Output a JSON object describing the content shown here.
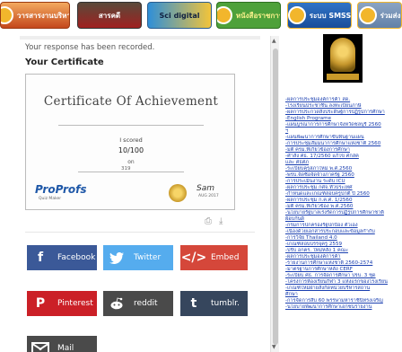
{
  "banners": [
    {
      "name": "banner-school-th",
      "text": "วารสารงานบริหาร"
    },
    {
      "name": "banner-video",
      "text": "สารคดี"
    },
    {
      "name": "banner-digital",
      "text": "Sci digital"
    },
    {
      "name": "banner-green",
      "text": "หนังสือราชการ"
    },
    {
      "name": "banner-blue",
      "text": "ระบบ SMSS"
    },
    {
      "name": "banner-grey",
      "text": "ร่วมส่ง"
    }
  ],
  "form": {
    "recorded_text": "Your response has been recorded.",
    "certificate_heading": "Your Certificate"
  },
  "certificate": {
    "title": "Certificate Of Achievement",
    "scored_label": "I scored",
    "score": "10/100",
    "on_label": "on",
    "id_text": "319",
    "logo": "ProProfs",
    "logo_sub": "Quiz Maker",
    "sign_text": "Sam",
    "sign_date": "AUG 2017"
  },
  "share": {
    "facebook": "Facebook",
    "twitter": "Twitter",
    "embed": "Embed",
    "pinterest": "Pinterest",
    "reddit": "reddit",
    "tumblr": "tumblr.",
    "mail": "Mail"
  },
  "icons": {
    "facebook": "f",
    "twitter": "bird",
    "embed": "</>",
    "pinterest": "P",
    "reddit": "alien",
    "tumblr": "t",
    "mail": "envelope",
    "print": "⎙",
    "download": "⤓"
  },
  "sidebar": {
    "links": [
      "-ผลการประชุมองค์การค้า สด.",
      "-โรงเรียนประชาชื่น ลงทะเบียนภาษี",
      "-ผลการประกวดสิ่งประดิษฐ์การปฏิรูปการศึกษา",
      "-English Programe",
      "-แผนบูรณาการการศึกษาจังหวัดชลบุรี 2560",
      "ฯ",
      "-แผนพัฒนาการศึกษาขั้นพื้นฐานแผน",
      "-การประชุมสัมมนาการศึกษาแห่งชาติ 2560",
      "-มติ ครม.ที่เกี่ยวข้องการศึกษา",
      "-คำสั่ง ศธ. 17/2560 แก้ไข ศกสค",
      "และ ศธศภ",
      "-ระเบียบคุรุสภาใหม่ พ.ศ.2560",
      "-พรบ.จัดซื้อจัดจ้างภาครัฐ 2560",
      "-การประเมินงาน ระดับ ICU",
      "-ผลการประชุม กศจ.ทั่วประเทศ",
      "-กำหนดและเกณฑ์สอบครูปกติ ปี 2560",
      "-ผลการประชุม ก.ค.ศ. 1/2560",
      "-มติ ครม.ที่เกี่ยวข้อง พ.ศ.2560",
      "-นโยบายรัฐบาลเร่งรัดการปฏิรูปการศึกษาชาติ",
      "ฝ้อบกันดี",
      "-กรมการปกครองรัฐปกป้อง ตัวเอง",
      "-เนื่องด้วยเอกสารประกอบและข้อมูลกำกับ",
      "-การวิจัย Thailand 4.0",
      "-เกณฑ์สอบบรรจุครู 2559",
      "-ปรับ อกคร. ใหม่หลัง 1 คณะ",
      "-ผลการประชุมองค์การค้า",
      "-รายงานการศึกษาแห่งชาติ 2560-2574",
      "-มาตรฐานการศึกษาหลัง CERF",
      "-ระเบียบ ศธ. การจัดการศึกษา ปรบ. 3 ชุด",
      "-โครงการห้องเรียนกีฬา 3 แห่งแรกของโรงเรียน",
      "-เกณฑ์ใหม่ฝ่ายสังกัดหน่วยบริหารสถาน",
      "ศึกษา",
      "-การจัดการสืบ 60 พรรษามหาราชินีทรงเจริญ",
      "-นโยบายพัฒนาการศึกษาเอกชนรายงาน"
    ]
  }
}
